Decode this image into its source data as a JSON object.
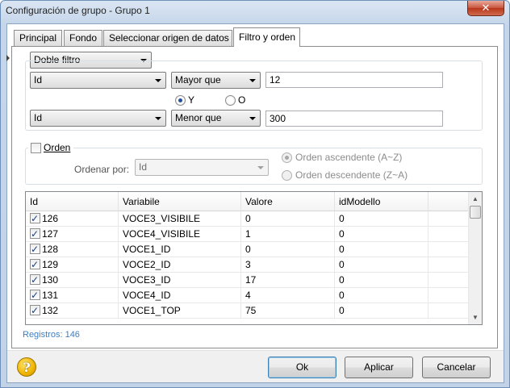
{
  "window": {
    "title": "Configuración de grupo - Grupo 1",
    "close_glyph": "✕"
  },
  "tabs": [
    "Principal",
    "Fondo",
    "Seleccionar origen de datos",
    "Filtro y orden"
  ],
  "filter": {
    "mode": "Doble filtro",
    "row1": {
      "field": "Id",
      "operator": "Mayor que",
      "value": "12"
    },
    "logic": {
      "and_label": "Y",
      "or_label": "O",
      "selected": "Y"
    },
    "row2": {
      "field": "Id",
      "operator": "Menor que",
      "value": "300"
    }
  },
  "order": {
    "enabled": false,
    "label": "Orden",
    "sort_by_label": "Ordenar por:",
    "sort_by_value": "Id",
    "asc_label": "Orden ascendente (A~Z)",
    "desc_label": "Orden descendente (Z~A)",
    "selected": "asc"
  },
  "grid": {
    "columns": [
      "Id",
      "Variabile",
      "Valore",
      "idModello"
    ],
    "rows": [
      {
        "id": "126",
        "variabile": "VOCE3_VISIBILE",
        "valore": "0",
        "idModello": "0",
        "checked": true
      },
      {
        "id": "127",
        "variabile": "VOCE4_VISIBILE",
        "valore": "1",
        "idModello": "0",
        "checked": true
      },
      {
        "id": "128",
        "variabile": "VOCE1_ID",
        "valore": "0",
        "idModello": "0",
        "checked": true
      },
      {
        "id": "129",
        "variabile": "VOCE2_ID",
        "valore": "3",
        "idModello": "0",
        "checked": true
      },
      {
        "id": "130",
        "variabile": "VOCE3_ID",
        "valore": "17",
        "idModello": "0",
        "checked": true
      },
      {
        "id": "131",
        "variabile": "VOCE4_ID",
        "valore": "4",
        "idModello": "0",
        "checked": true
      },
      {
        "id": "132",
        "variabile": "VOCE1_TOP",
        "valore": "75",
        "idModello": "0",
        "checked": true
      }
    ]
  },
  "records_label": "Registros: 146",
  "buttons": {
    "ok": "Ok",
    "apply": "Aplicar",
    "cancel": "Cancelar"
  },
  "help_glyph": "?"
}
